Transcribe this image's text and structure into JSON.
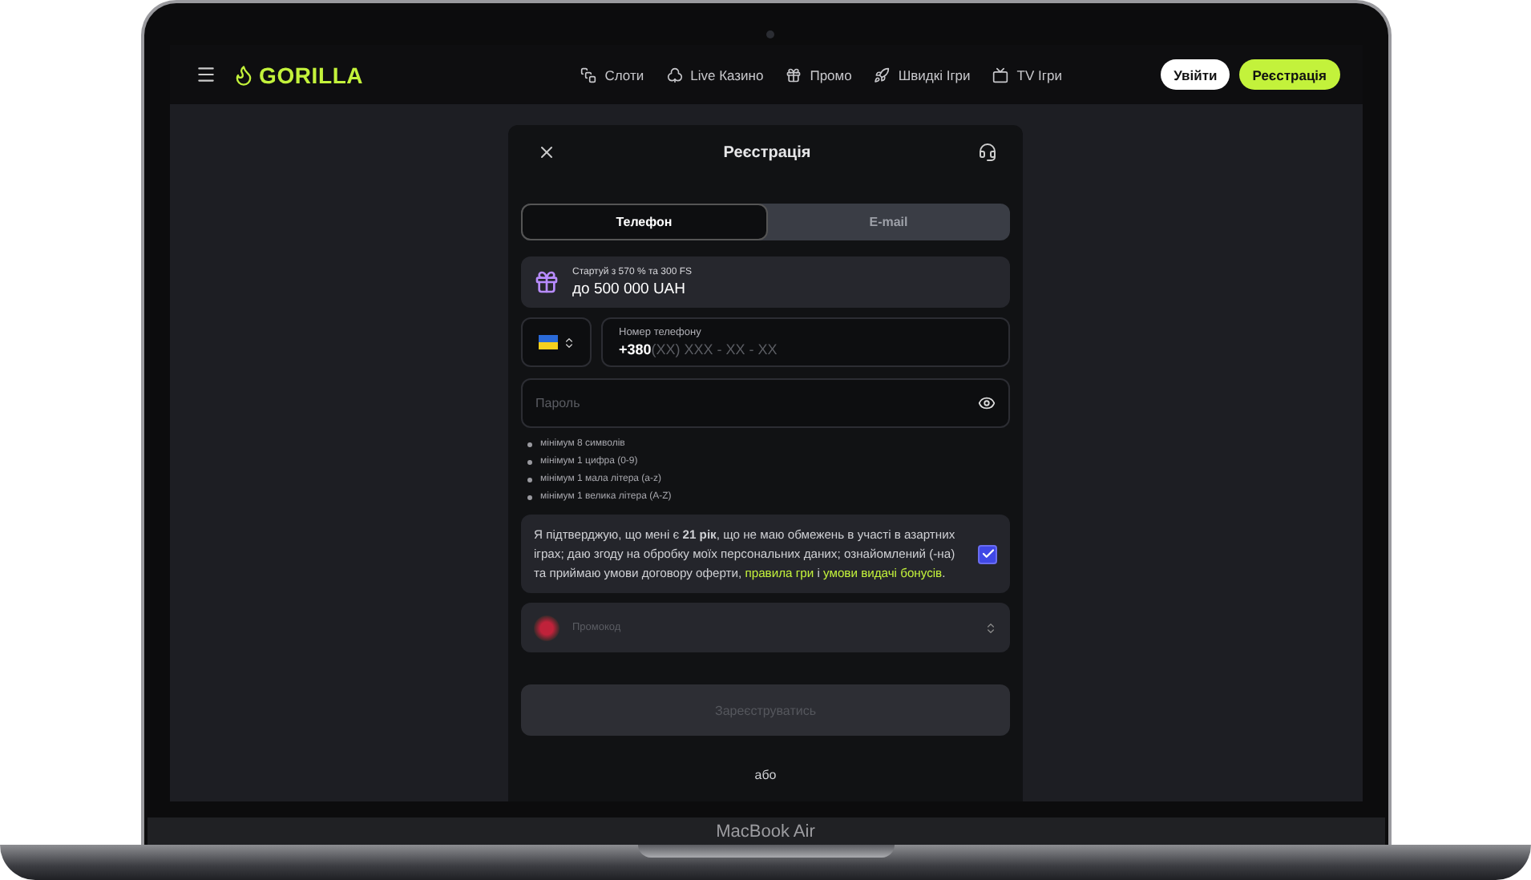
{
  "device": {
    "label": "MacBook Air"
  },
  "header": {
    "logo": "GORILLA",
    "nav": [
      {
        "kind": "slots",
        "label": "Слоти"
      },
      {
        "kind": "live",
        "label": "Live Казино"
      },
      {
        "kind": "promo",
        "label": "Промо"
      },
      {
        "kind": "fast",
        "label": "Швидкі Ігри"
      },
      {
        "kind": "tv",
        "label": "TV Ігри"
      }
    ],
    "login": "Увійти",
    "register": "Реєстрація"
  },
  "modal": {
    "title": "Реєстрація",
    "tabs": [
      {
        "label": "Телефон",
        "selected": true
      },
      {
        "label": "E-mail",
        "selected": false
      }
    ],
    "bonus": {
      "caption": "Стартуй з 570 % та 300 FS",
      "amount": "до 500 000 UAH"
    },
    "phone": {
      "label": "Номер телефону",
      "code": "+380",
      "placeholder": "(XX) XXX - XX - XX"
    },
    "password": {
      "placeholder": "Пароль"
    },
    "rules": [
      "мінімум 8 символів",
      "мінімум 1 цифра (0-9)",
      "мінімум 1 мала літера (a-z)",
      "мінімум 1 велика літера (A-Z)"
    ],
    "consent": {
      "text": "Я підтверджую, що мені є **21 рік**, що не маю обмежень в участі в азартних іграх; даю згоду на обробку моїх персональних даних; ознайомлений (-на) та приймаю умови договору оферти,",
      "links": [
        "правила гри",
        "умови видачі бонусів"
      ],
      "joiner": "і",
      "end": ".",
      "checked": true
    },
    "promocode": {
      "placeholder": "Промокод"
    },
    "submit": {
      "label": "Зареєструватись",
      "disabled": true
    },
    "or": "або"
  }
}
